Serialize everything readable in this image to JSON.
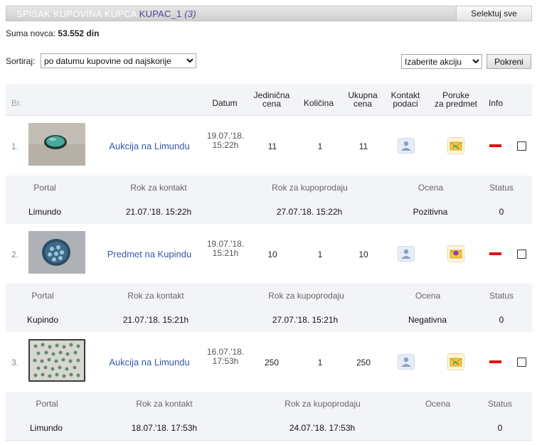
{
  "header": {
    "title_prefix": "SPISAK KUPOVINA KUPCA",
    "username": "KUPAC_1",
    "count": "(3)",
    "select_all_label": "Selektuj sve"
  },
  "summary": {
    "label": "Suma novca:",
    "value": "53.552 din"
  },
  "sort": {
    "label": "Sortiraj:",
    "selected": "po datumu kupovine od najskorije"
  },
  "action": {
    "selected": "Izaberite akciju",
    "button_label": "Pokreni"
  },
  "columns": {
    "br": "Br.",
    "datum": "Datum",
    "jedinicna_l1": "Jedinična",
    "jedinicna_l2": "cena",
    "kolicina": "Količina",
    "ukupna_l1": "Ukupna",
    "ukupna_l2": "cena",
    "kontakt_l1": "Kontakt",
    "kontakt_l2": "podaci",
    "poruke_l1": "Poruke",
    "poruke_l2": "za predmet",
    "info": "Info"
  },
  "sub_columns": {
    "portal": "Portal",
    "rok_kontakt": "Rok za kontakt",
    "rok_kupoprodaja": "Rok za kupoprodaju",
    "ocena": "Ocena",
    "status": "Status"
  },
  "items": [
    {
      "num": "1.",
      "title": "Aukcija na Limundu",
      "date_l1": "19.07.'18.",
      "date_l2": "15:22h",
      "unit_price": "11",
      "qty": "1",
      "total": "11",
      "portal": "Limundo",
      "rok_kontakt": "21.07.'18. 15:22h",
      "rok_kupoprodaja": "27.07.'18. 15:22h",
      "ocena": "Pozitivna",
      "status": "0"
    },
    {
      "num": "2.",
      "title": "Predmet na Kupindu",
      "date_l1": "19.07.'18.",
      "date_l2": "15:21h",
      "unit_price": "10",
      "qty": "1",
      "total": "10",
      "portal": "Kupindo",
      "rok_kontakt": "21.07.'18. 15:21h",
      "rok_kupoprodaja": "27.07.'18. 15:21h",
      "ocena": "Negativna",
      "status": "0"
    },
    {
      "num": "3.",
      "title": "Aukcija na Limundu",
      "date_l1": "16.07.'18.",
      "date_l2": "17:53h",
      "unit_price": "250",
      "qty": "1",
      "total": "250",
      "portal": "Limundo",
      "rok_kontakt": "18.07.'18. 17:53h",
      "rok_kupoprodaja": "24.07.'18. 17:53h",
      "ocena": "",
      "status": "0"
    }
  ],
  "icons": {
    "kontakt": "contact-card-icon",
    "poruke": "envelope-icon",
    "info": "minus-icon"
  },
  "colors": {
    "accent": "#3558a8",
    "info_dash": "#e01111",
    "header_username": "#4b4594"
  }
}
